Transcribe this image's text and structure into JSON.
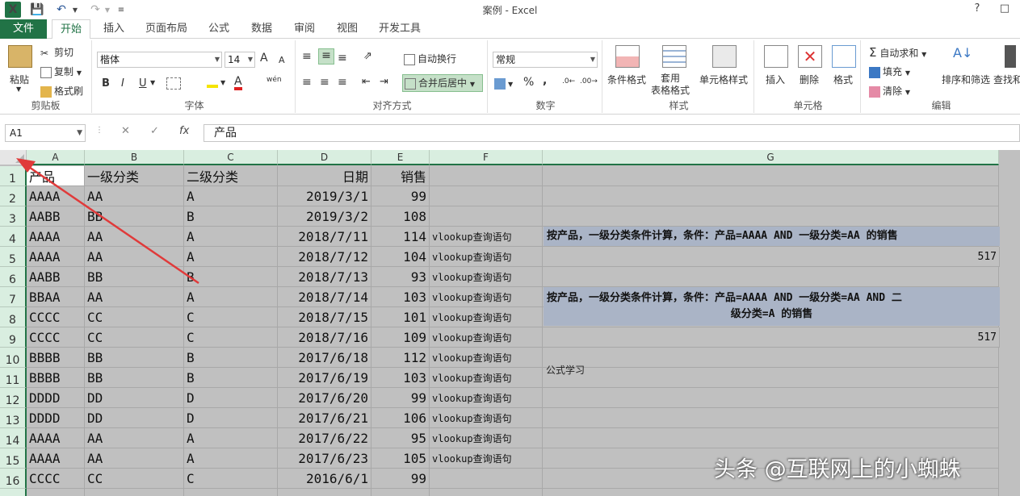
{
  "window": {
    "title": "案例 - Excel",
    "help": "?"
  },
  "tabs": [
    "文件",
    "开始",
    "插入",
    "页面布局",
    "公式",
    "数据",
    "审阅",
    "视图",
    "开发工具"
  ],
  "ribbon": {
    "clipboard": {
      "paste": "粘贴",
      "cut": "剪切",
      "copy": "复制",
      "format_painter": "格式刷",
      "label": "剪贴板"
    },
    "font": {
      "name": "楷体",
      "size": "14",
      "bold": "B",
      "italic": "I",
      "underline": "U",
      "grow": "A",
      "shrink": "A",
      "phonetic": "wén",
      "label": "字体"
    },
    "alignment": {
      "wrap": "自动换行",
      "merge": "合并后居中",
      "label": "对齐方式"
    },
    "number": {
      "format": "常规",
      "percent": "%",
      "comma": ",",
      "label": "数字"
    },
    "styles": {
      "conditional": "条件格式",
      "table": "套用\n表格格式",
      "cell_styles": "单元格样式",
      "label": "样式"
    },
    "cells": {
      "insert": "插入",
      "delete": "删除",
      "format": "格式",
      "label": "单元格"
    },
    "editing": {
      "autosum": "自动求和",
      "fill": "填充",
      "clear": "清除",
      "sort": "排序和筛选",
      "find": "查找和",
      "label": "编辑"
    }
  },
  "formula_bar": {
    "name_box": "A1",
    "fx": "fx",
    "content": "产品"
  },
  "sheet": {
    "columns": [
      "A",
      "B",
      "C",
      "D",
      "E",
      "F",
      "G"
    ],
    "rows": [
      [
        "产品",
        "一级分类",
        "二级分类",
        "日期",
        "销售",
        ""
      ],
      [
        "AAAA",
        "AA",
        "A",
        "2019/3/1",
        "99",
        ""
      ],
      [
        "AABB",
        "BB",
        "B",
        "2019/3/2",
        "108",
        ""
      ],
      [
        "AAAA",
        "AA",
        "A",
        "2018/7/11",
        "114",
        "vlookup查询语句"
      ],
      [
        "AAAA",
        "AA",
        "A",
        "2018/7/12",
        "104",
        "vlookup查询语句"
      ],
      [
        "AABB",
        "BB",
        "B",
        "2018/7/13",
        "93",
        "vlookup查询语句"
      ],
      [
        "BBAA",
        "AA",
        "A",
        "2018/7/14",
        "103",
        "vlookup查询语句"
      ],
      [
        "CCCC",
        "CC",
        "C",
        "2018/7/15",
        "101",
        "vlookup查询语句"
      ],
      [
        "CCCC",
        "CC",
        "C",
        "2018/7/16",
        "109",
        "vlookup查询语句"
      ],
      [
        "BBBB",
        "BB",
        "B",
        "2017/6/18",
        "112",
        "vlookup查询语句"
      ],
      [
        "BBBB",
        "BB",
        "B",
        "2017/6/19",
        "103",
        "vlookup查询语句"
      ],
      [
        "DDDD",
        "DD",
        "D",
        "2017/6/20",
        "99",
        "vlookup查询语句"
      ],
      [
        "DDDD",
        "DD",
        "D",
        "2017/6/21",
        "106",
        "vlookup查询语句"
      ],
      [
        "AAAA",
        "AA",
        "A",
        "2017/6/22",
        "95",
        "vlookup查询语句"
      ],
      [
        "AAAA",
        "AA",
        "A",
        "2017/6/23",
        "105",
        "vlookup查询语句"
      ],
      [
        "CCCC",
        "CC",
        "C",
        "2016/6/1",
        "99",
        ""
      ]
    ],
    "g_column": {
      "g3": "公式学习",
      "g4": "按产品，一级分类条件计算，条件：产品=AAAA AND 一级分类=AA 的销售",
      "g5": "517",
      "g7_line1": "按产品，一级分类条件计算，条件：产品=AAAA AND 一级分类=AA AND 二",
      "g7_line2": "级分类=A 的销售",
      "g9": "517"
    }
  },
  "watermark": "头条 @互联网上的小蜘蛛",
  "colors": {
    "accent": "#217346",
    "band": "#aab4c6",
    "arrow": "#e03a3a"
  }
}
